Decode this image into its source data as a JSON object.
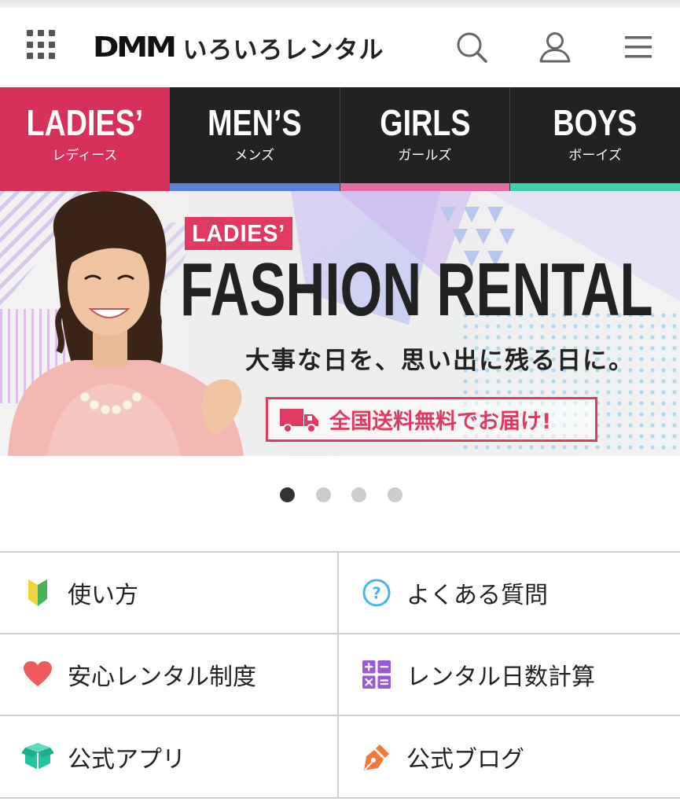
{
  "header": {
    "brand": "DMM",
    "service_name": "いろいろレンタル",
    "icons": [
      "grid-menu-icon",
      "search-icon",
      "user-icon",
      "hamburger-menu-icon"
    ]
  },
  "tabs": [
    {
      "title": "LADIES’",
      "sub": "レディース",
      "bar_color": "#d7305a",
      "active": true
    },
    {
      "title": "MEN’S",
      "sub": "メンズ",
      "bar_color": "#5b7fd9",
      "active": false
    },
    {
      "title": "GIRLS",
      "sub": "ガールズ",
      "bar_color": "#e46aa8",
      "active": false
    },
    {
      "title": "BOYS",
      "sub": "ボーイズ",
      "bar_color": "#3fcfb0",
      "active": false
    }
  ],
  "banner": {
    "tag": "LADIES’",
    "title": "FASHION RENTAL",
    "tagline": "大事な日を、思い出に残る日に。",
    "shipping": "全国送料無料でお届け!",
    "accent_color": "#e03a63"
  },
  "carousel": {
    "total": 4,
    "active_index": 0
  },
  "links": [
    {
      "label": "使い方",
      "icon": "beginner-leaf-icon"
    },
    {
      "label": "よくある質問",
      "icon": "question-circle-icon"
    },
    {
      "label": "安心レンタル制度",
      "icon": "heart-icon"
    },
    {
      "label": "レンタル日数計算",
      "icon": "calculator-icon"
    },
    {
      "label": "公式アプリ",
      "icon": "app-box-icon"
    },
    {
      "label": "公式ブログ",
      "icon": "pen-nib-icon"
    }
  ]
}
